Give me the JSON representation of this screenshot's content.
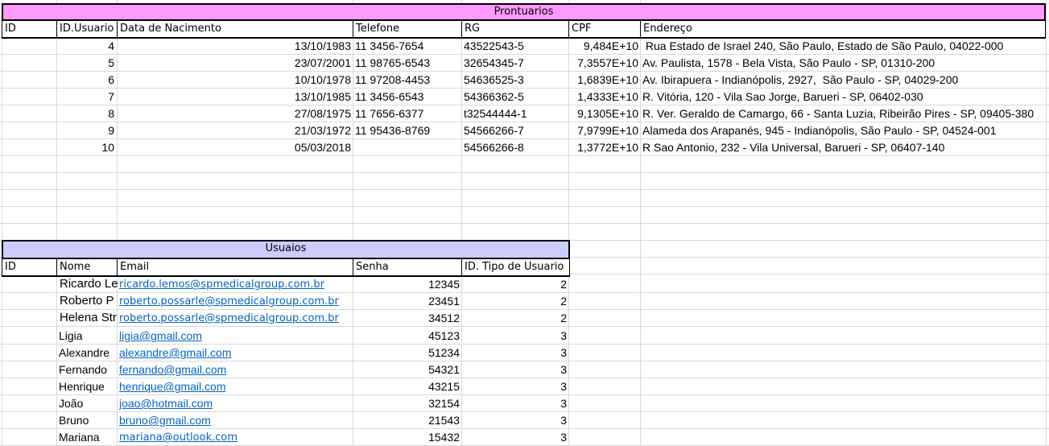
{
  "prontuarios": {
    "title": "Prontuarios",
    "headers": [
      "ID",
      "ID.Usuario",
      "Data de Nacimento",
      "Telefone",
      "RG",
      "CPF",
      "Endereço"
    ],
    "rows": [
      {
        "id_usuario": "4",
        "data": "13/10/1983",
        "telefone": "11 3456-7654",
        "rg": "43522543-5",
        "cpf": "9,484E+10",
        "endereco": " Rua Estado de Israel 240, São Paulo, Estado de São Paulo, 04022-000"
      },
      {
        "id_usuario": "5",
        "data": "23/07/2001",
        "telefone": "11 98765-6543",
        "rg": "32654345-7",
        "cpf": "7,3557E+10",
        "endereco": "Av. Paulista, 1578 - Bela Vista, São Paulo - SP, 01310-200"
      },
      {
        "id_usuario": "6",
        "data": "10/10/1978",
        "telefone": "11 97208-4453",
        "rg": "54636525-3",
        "cpf": "1,6839E+10",
        "endereco": "Av. Ibirapuera - Indianópolis, 2927,  São Paulo - SP, 04029-200"
      },
      {
        "id_usuario": "7",
        "data": "13/10/1985",
        "telefone": "11 3456-6543",
        "rg": "54366362-5",
        "cpf": "1,4333E+10",
        "endereco": "R. Vitória, 120 - Vila Sao Jorge, Barueri - SP, 06402-030"
      },
      {
        "id_usuario": "8",
        "data": "27/08/1975",
        "telefone": "11 7656-6377",
        "rg": "t32544444-1",
        "cpf": "9,1305E+10",
        "endereco": "R. Ver. Geraldo de Camargo, 66 - Santa Luzia, Ribeirão Pires - SP, 09405-380"
      },
      {
        "id_usuario": "9",
        "data": "21/03/1972",
        "telefone": "11 95436-8769",
        "rg": "54566266-7",
        "cpf": "7,9799E+10",
        "endereco": "Alameda dos Arapanés, 945 - Indianópolis, São Paulo - SP, 04524-001"
      },
      {
        "id_usuario": "10",
        "data": "05/03/2018",
        "telefone": "",
        "rg": "54566266-8",
        "cpf": "1,3772E+10",
        "endereco": "R Sao Antonio, 232 - Vila Universal, Barueri - SP, 06407-140"
      }
    ]
  },
  "usuarios": {
    "title": "Usuaios",
    "headers": [
      "ID",
      "Nome",
      "Email",
      "Senha",
      "ID. Tipo de Usuario"
    ],
    "rows": [
      {
        "nome": "Ricardo Le",
        "email": "ricardo.lemos@spmedicalgroup.com.br",
        "senha": "12345",
        "tipo": "2"
      },
      {
        "nome": "Roberto P",
        "email": "roberto.possarle@spmedicalgroup.com.br",
        "senha": "23451",
        "tipo": "2"
      },
      {
        "nome": "Helena Str",
        "email": "roberto.possarle@spmedicalgroup.com.br",
        "senha": "34512",
        "tipo": "2"
      },
      {
        "nome": "Ligia",
        "email": "ligia@gmail.com",
        "senha": "45123",
        "tipo": "3"
      },
      {
        "nome": "Alexandre",
        "email": "alexandre@gmail.com",
        "senha": "51234",
        "tipo": "3"
      },
      {
        "nome": "Fernando",
        "email": "fernando@gmail.com",
        "senha": "54321",
        "tipo": "3"
      },
      {
        "nome": "Henrique",
        "email": "henrique@gmail.com",
        "senha": "43215",
        "tipo": "3"
      },
      {
        "nome": "João",
        "email": "joao@hotmail.com",
        "senha": "32154",
        "tipo": "3"
      },
      {
        "nome": "Bruno",
        "email": "bruno@gmail.com",
        "senha": "21543",
        "tipo": "3"
      },
      {
        "nome": "Mariana",
        "email": "mariana@outlook.com",
        "senha": "15432",
        "tipo": "3"
      }
    ]
  },
  "colors": {
    "prontuarios_header": "#fe99ff",
    "usuarios_header": "#ccccff",
    "link": "#0563c1",
    "gridline": "#d9d9d9"
  }
}
